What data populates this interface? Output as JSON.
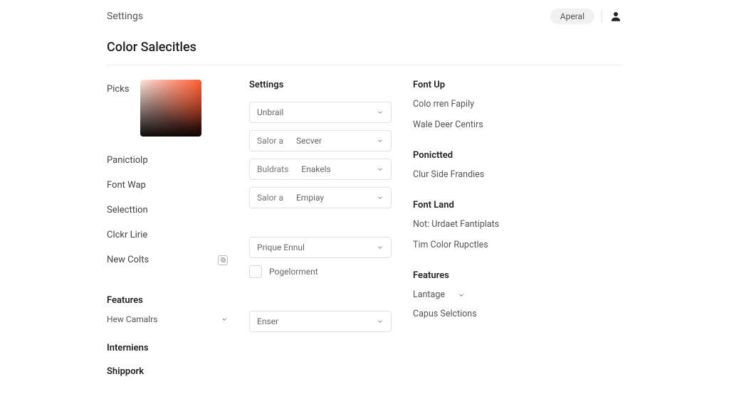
{
  "topbar": {
    "title": "Settings",
    "pill": "Aperal"
  },
  "page": {
    "title": "Color Salecitles"
  },
  "left": {
    "picks": "Picks",
    "panictiolp": "Panictiolp",
    "font_wap": "Font Wap",
    "selecttion": "Selecttion",
    "clckr_line": "Clckr Lirie",
    "new_colts": "New Colts",
    "features_h": "Features",
    "hew_camalrs": "Hew Camalrs",
    "interniens_h": "Interniens",
    "shippork_h": "Shippork"
  },
  "mid": {
    "settings_h": "Settings",
    "select_unbrail": "Unbrail",
    "pair1_a": "Salor a",
    "pair1_b": "Secver",
    "pair2_a": "Buldrats",
    "pair2_b": "Enakels",
    "pair3_a": "Salor a",
    "pair3_b": "Empiay",
    "select_prique": "Prique Ennul",
    "checkbox_label": "Pogelorment",
    "select_enser": "Enser"
  },
  "right": {
    "font_up_h": "Font Up",
    "colo_rren": "Colo rren Fapily",
    "wale_deer": "Wale Deer Centirs",
    "ponictted_h": "Ponictted",
    "clur_side": "Clur Side Frandies",
    "font_land_h": "Font Land",
    "not_urdaet": "Not: Urdaet Fantiplats",
    "tim_color": "Tim Color Rupctles",
    "features_h": "Features",
    "lantage": "Lantage",
    "capus": "Capus Selctions"
  }
}
